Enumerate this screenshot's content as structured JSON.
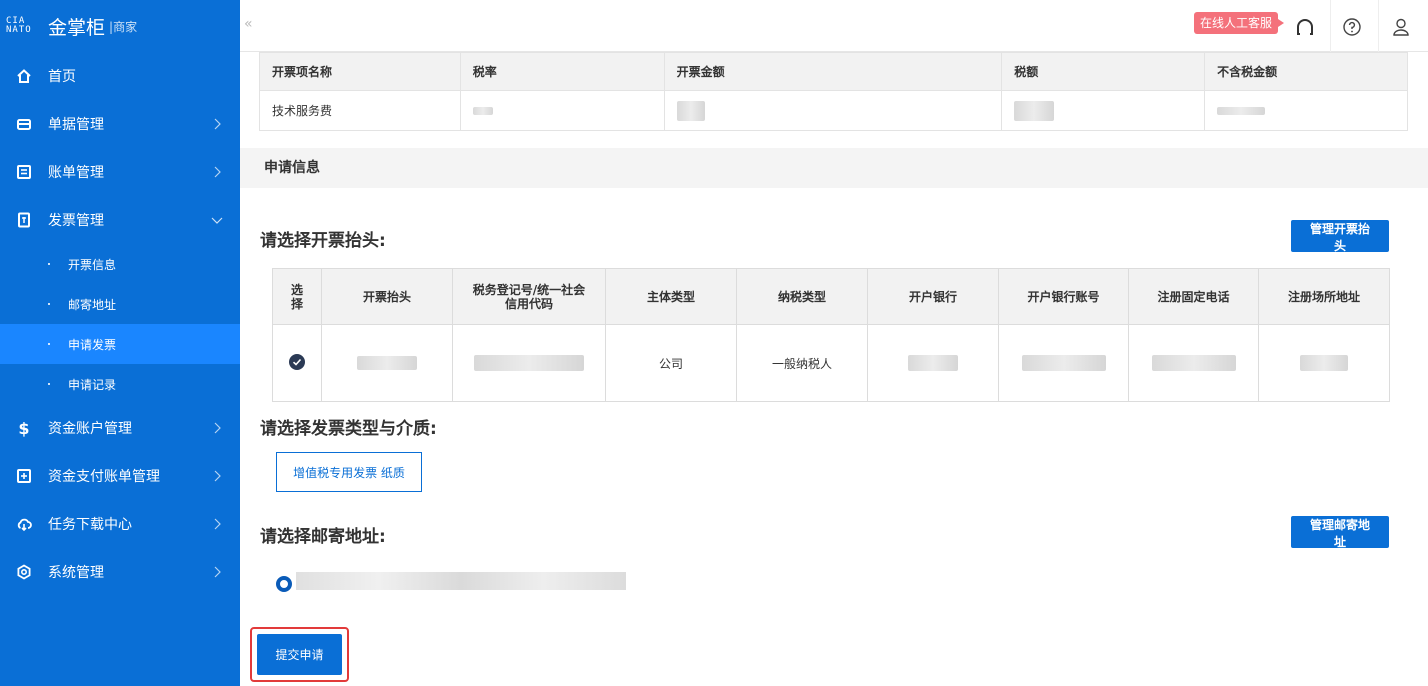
{
  "brand": {
    "mark": "CIAO\nNATO",
    "name": "金掌柜",
    "suffix": "商家"
  },
  "sidebar": {
    "items": [
      {
        "label": "首页",
        "icon": "home-icon"
      },
      {
        "label": "单据管理",
        "icon": "receipt-icon"
      },
      {
        "label": "账单管理",
        "icon": "bill-icon"
      },
      {
        "label": "发票管理",
        "icon": "invoice-icon",
        "expanded": true
      },
      {
        "label": "资金账户管理",
        "icon": "dollar-icon"
      },
      {
        "label": "资金支付账单管理",
        "icon": "payment-icon"
      },
      {
        "label": "任务下载中心",
        "icon": "cloud-download-icon"
      },
      {
        "label": "系统管理",
        "icon": "settings-icon"
      }
    ],
    "subitems": [
      {
        "label": "开票信息"
      },
      {
        "label": "邮寄地址"
      },
      {
        "label": "申请发票",
        "active": true
      },
      {
        "label": "申请记录"
      }
    ]
  },
  "topbar": {
    "collapse_label": "«",
    "cs_label": "在线人工客服"
  },
  "summary_table": {
    "headers": [
      "开票项名称",
      "税率",
      "开票金额",
      "税额",
      "不含税金额"
    ],
    "row": [
      "技术服务费",
      "",
      "",
      "",
      ""
    ]
  },
  "section": {
    "title": "申请信息"
  },
  "invoice_title": {
    "heading": "请选择开票抬头:",
    "manage_label": "管理开票抬头",
    "headers": [
      "选择",
      "开票抬头",
      "税务登记号/统一社会信用代码",
      "主体类型",
      "纳税类型",
      "开户银行",
      "开户银行账号",
      "注册固定电话",
      "注册场所地址"
    ],
    "row": [
      "",
      "",
      "",
      "公司",
      "一般纳税人",
      "",
      "",
      "",
      ""
    ]
  },
  "invoice_type": {
    "heading": "请选择发票类型与介质:",
    "option_label": "增值税专用发票 纸质"
  },
  "address": {
    "heading": "请选择邮寄地址:",
    "manage_label": "管理邮寄地址",
    "value": ""
  },
  "submit": {
    "label": "提交申请"
  },
  "colors": {
    "primary": "#0a6fd6",
    "sidebar": "#0a6fd6",
    "active": "#1a86ff",
    "badge": "#f4717b",
    "highlight": "#e23a3a"
  }
}
